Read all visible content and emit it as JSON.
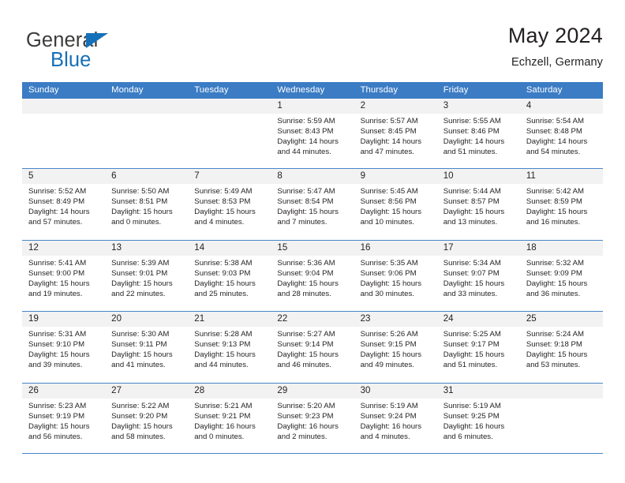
{
  "branding": {
    "name_primary": "General",
    "name_secondary": "Blue",
    "triangle_color": "#1470b8",
    "primary_color": "#3c3c3b"
  },
  "header": {
    "title": "May 2024",
    "subtitle": "Echzell, Germany"
  },
  "theme": {
    "header_row_bg": "#3b7cc4",
    "header_row_text": "#ffffff",
    "day_band_bg": "#f2f2f2",
    "grid_line": "#4a86c8",
    "body_text": "#231f20"
  },
  "weekdays": [
    "Sunday",
    "Monday",
    "Tuesday",
    "Wednesday",
    "Thursday",
    "Friday",
    "Saturday"
  ],
  "labels": {
    "sunrise_prefix": "Sunrise:",
    "sunset_prefix": "Sunset:",
    "daylight_prefix": "Daylight:"
  },
  "weeks": [
    [
      {
        "day": "",
        "empty": true
      },
      {
        "day": "",
        "empty": true
      },
      {
        "day": "",
        "empty": true
      },
      {
        "day": "1",
        "sunrise": "Sunrise: 5:59 AM",
        "sunset": "Sunset: 8:43 PM",
        "daylight_line1": "Daylight: 14 hours",
        "daylight_line2": "and 44 minutes."
      },
      {
        "day": "2",
        "sunrise": "Sunrise: 5:57 AM",
        "sunset": "Sunset: 8:45 PM",
        "daylight_line1": "Daylight: 14 hours",
        "daylight_line2": "and 47 minutes."
      },
      {
        "day": "3",
        "sunrise": "Sunrise: 5:55 AM",
        "sunset": "Sunset: 8:46 PM",
        "daylight_line1": "Daylight: 14 hours",
        "daylight_line2": "and 51 minutes."
      },
      {
        "day": "4",
        "sunrise": "Sunrise: 5:54 AM",
        "sunset": "Sunset: 8:48 PM",
        "daylight_line1": "Daylight: 14 hours",
        "daylight_line2": "and 54 minutes."
      }
    ],
    [
      {
        "day": "5",
        "sunrise": "Sunrise: 5:52 AM",
        "sunset": "Sunset: 8:49 PM",
        "daylight_line1": "Daylight: 14 hours",
        "daylight_line2": "and 57 minutes."
      },
      {
        "day": "6",
        "sunrise": "Sunrise: 5:50 AM",
        "sunset": "Sunset: 8:51 PM",
        "daylight_line1": "Daylight: 15 hours",
        "daylight_line2": "and 0 minutes."
      },
      {
        "day": "7",
        "sunrise": "Sunrise: 5:49 AM",
        "sunset": "Sunset: 8:53 PM",
        "daylight_line1": "Daylight: 15 hours",
        "daylight_line2": "and 4 minutes."
      },
      {
        "day": "8",
        "sunrise": "Sunrise: 5:47 AM",
        "sunset": "Sunset: 8:54 PM",
        "daylight_line1": "Daylight: 15 hours",
        "daylight_line2": "and 7 minutes."
      },
      {
        "day": "9",
        "sunrise": "Sunrise: 5:45 AM",
        "sunset": "Sunset: 8:56 PM",
        "daylight_line1": "Daylight: 15 hours",
        "daylight_line2": "and 10 minutes."
      },
      {
        "day": "10",
        "sunrise": "Sunrise: 5:44 AM",
        "sunset": "Sunset: 8:57 PM",
        "daylight_line1": "Daylight: 15 hours",
        "daylight_line2": "and 13 minutes."
      },
      {
        "day": "11",
        "sunrise": "Sunrise: 5:42 AM",
        "sunset": "Sunset: 8:59 PM",
        "daylight_line1": "Daylight: 15 hours",
        "daylight_line2": "and 16 minutes."
      }
    ],
    [
      {
        "day": "12",
        "sunrise": "Sunrise: 5:41 AM",
        "sunset": "Sunset: 9:00 PM",
        "daylight_line1": "Daylight: 15 hours",
        "daylight_line2": "and 19 minutes."
      },
      {
        "day": "13",
        "sunrise": "Sunrise: 5:39 AM",
        "sunset": "Sunset: 9:01 PM",
        "daylight_line1": "Daylight: 15 hours",
        "daylight_line2": "and 22 minutes."
      },
      {
        "day": "14",
        "sunrise": "Sunrise: 5:38 AM",
        "sunset": "Sunset: 9:03 PM",
        "daylight_line1": "Daylight: 15 hours",
        "daylight_line2": "and 25 minutes."
      },
      {
        "day": "15",
        "sunrise": "Sunrise: 5:36 AM",
        "sunset": "Sunset: 9:04 PM",
        "daylight_line1": "Daylight: 15 hours",
        "daylight_line2": "and 28 minutes."
      },
      {
        "day": "16",
        "sunrise": "Sunrise: 5:35 AM",
        "sunset": "Sunset: 9:06 PM",
        "daylight_line1": "Daylight: 15 hours",
        "daylight_line2": "and 30 minutes."
      },
      {
        "day": "17",
        "sunrise": "Sunrise: 5:34 AM",
        "sunset": "Sunset: 9:07 PM",
        "daylight_line1": "Daylight: 15 hours",
        "daylight_line2": "and 33 minutes."
      },
      {
        "day": "18",
        "sunrise": "Sunrise: 5:32 AM",
        "sunset": "Sunset: 9:09 PM",
        "daylight_line1": "Daylight: 15 hours",
        "daylight_line2": "and 36 minutes."
      }
    ],
    [
      {
        "day": "19",
        "sunrise": "Sunrise: 5:31 AM",
        "sunset": "Sunset: 9:10 PM",
        "daylight_line1": "Daylight: 15 hours",
        "daylight_line2": "and 39 minutes."
      },
      {
        "day": "20",
        "sunrise": "Sunrise: 5:30 AM",
        "sunset": "Sunset: 9:11 PM",
        "daylight_line1": "Daylight: 15 hours",
        "daylight_line2": "and 41 minutes."
      },
      {
        "day": "21",
        "sunrise": "Sunrise: 5:28 AM",
        "sunset": "Sunset: 9:13 PM",
        "daylight_line1": "Daylight: 15 hours",
        "daylight_line2": "and 44 minutes."
      },
      {
        "day": "22",
        "sunrise": "Sunrise: 5:27 AM",
        "sunset": "Sunset: 9:14 PM",
        "daylight_line1": "Daylight: 15 hours",
        "daylight_line2": "and 46 minutes."
      },
      {
        "day": "23",
        "sunrise": "Sunrise: 5:26 AM",
        "sunset": "Sunset: 9:15 PM",
        "daylight_line1": "Daylight: 15 hours",
        "daylight_line2": "and 49 minutes."
      },
      {
        "day": "24",
        "sunrise": "Sunrise: 5:25 AM",
        "sunset": "Sunset: 9:17 PM",
        "daylight_line1": "Daylight: 15 hours",
        "daylight_line2": "and 51 minutes."
      },
      {
        "day": "25",
        "sunrise": "Sunrise: 5:24 AM",
        "sunset": "Sunset: 9:18 PM",
        "daylight_line1": "Daylight: 15 hours",
        "daylight_line2": "and 53 minutes."
      }
    ],
    [
      {
        "day": "26",
        "sunrise": "Sunrise: 5:23 AM",
        "sunset": "Sunset: 9:19 PM",
        "daylight_line1": "Daylight: 15 hours",
        "daylight_line2": "and 56 minutes."
      },
      {
        "day": "27",
        "sunrise": "Sunrise: 5:22 AM",
        "sunset": "Sunset: 9:20 PM",
        "daylight_line1": "Daylight: 15 hours",
        "daylight_line2": "and 58 minutes."
      },
      {
        "day": "28",
        "sunrise": "Sunrise: 5:21 AM",
        "sunset": "Sunset: 9:21 PM",
        "daylight_line1": "Daylight: 16 hours",
        "daylight_line2": "and 0 minutes."
      },
      {
        "day": "29",
        "sunrise": "Sunrise: 5:20 AM",
        "sunset": "Sunset: 9:23 PM",
        "daylight_line1": "Daylight: 16 hours",
        "daylight_line2": "and 2 minutes."
      },
      {
        "day": "30",
        "sunrise": "Sunrise: 5:19 AM",
        "sunset": "Sunset: 9:24 PM",
        "daylight_line1": "Daylight: 16 hours",
        "daylight_line2": "and 4 minutes."
      },
      {
        "day": "31",
        "sunrise": "Sunrise: 5:19 AM",
        "sunset": "Sunset: 9:25 PM",
        "daylight_line1": "Daylight: 16 hours",
        "daylight_line2": "and 6 minutes."
      },
      {
        "day": "",
        "empty": true
      }
    ]
  ]
}
